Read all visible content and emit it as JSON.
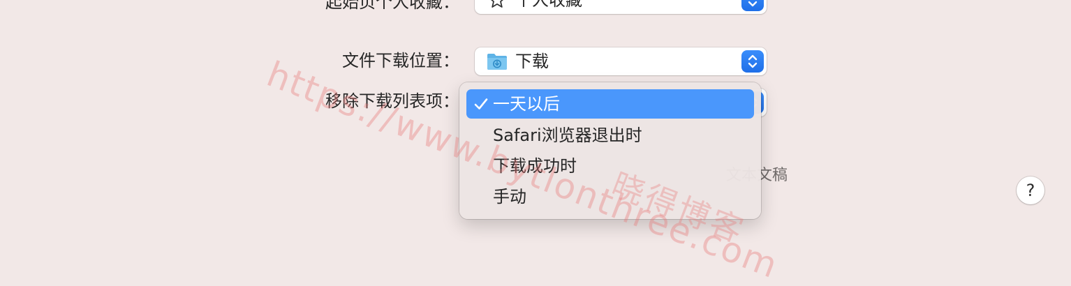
{
  "settings": {
    "homepage_row": {
      "label": "起始页个人收藏：",
      "value": "个人收藏",
      "icon": "star-icon"
    },
    "download_location_row": {
      "label": "文件下载位置：",
      "value": "下载",
      "icon": "folder-icon"
    },
    "remove_downloads_row": {
      "label": "移除下载列表项："
    },
    "partial_note": "文本文稿"
  },
  "dropdown": {
    "selected_index": 0,
    "items": [
      {
        "label": "一天以后",
        "selected": true
      },
      {
        "label": "Safari浏览器退出时",
        "selected": false
      },
      {
        "label": "下载成功时",
        "selected": false
      },
      {
        "label": "手动",
        "selected": false
      }
    ]
  },
  "help": {
    "label": "?"
  },
  "watermark": {
    "url": "https://www.bytlonthree.com",
    "text": "晓得博客"
  },
  "colors": {
    "background": "#f2e8e7",
    "accent": "#4a97fc",
    "stepper": "#2a7df4",
    "watermark": "#e87878"
  }
}
